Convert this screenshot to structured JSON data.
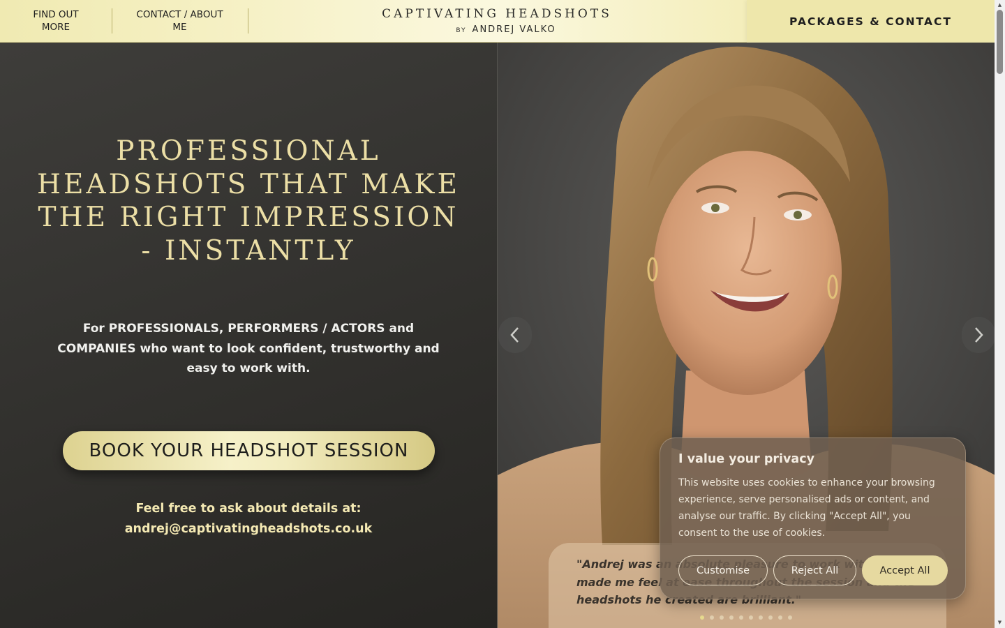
{
  "header": {
    "nav": [
      {
        "label": "FIND OUT\nMORE"
      },
      {
        "label": "CONTACT / ABOUT\nME"
      }
    ],
    "brand_title": "CAPTIVATING HEADSHOTS",
    "brand_by": "BY",
    "brand_name": "ANDREJ VALKO",
    "packages_label": "PACKAGES & CONTACT"
  },
  "hero": {
    "title": "PROFESSIONAL HEADSHOTS THAT MAKE THE RIGHT IMPRESSION - INSTANTLY",
    "subtitle": "For PROFESSIONALS, PERFORMERS / ACTORS and COMPANIES who want to look confident, trustworthy and easy to work with.",
    "cta_label": "BOOK YOUR HEADSHOT SESSION",
    "ask_line": "Feel free to ask about details at:",
    "email": "andrej@captivatingheadshots.co.uk"
  },
  "slider": {
    "testimonial": "\"Andrej was an absolute pleasure to work with. He made me feel at ease throughout the session and the headshots he created are brilliant.\"",
    "dot_count": 10,
    "active_dot": 0
  },
  "cookie": {
    "title": "I value your privacy",
    "text": "This website uses cookies to enhance your browsing experience, serve personalised ads or content, and analyse our traffic. By clicking \"Accept All\", you consent to the use of cookies.",
    "customise": "Customise",
    "reject": "Reject All",
    "accept": "Accept All"
  },
  "colors": {
    "header_bg": "#f4eebb",
    "accent_gold": "#ecdfa6",
    "panel_dark": "#31302d",
    "cta_gold": "#e9e0a8"
  }
}
